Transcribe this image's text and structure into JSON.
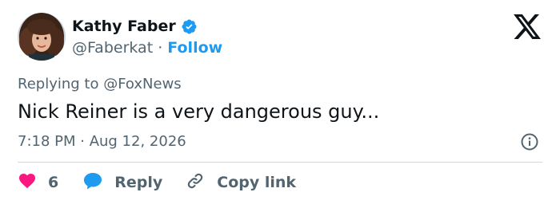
{
  "author": {
    "name": "Kathy Faber",
    "handle": "@Faberkat",
    "separator": "·",
    "follow_label": "Follow",
    "verified": true
  },
  "tweet": {
    "replying_to": "Replying to @FoxNews",
    "text": "Nick Reiner is a very dangerous guy...",
    "timestamp": "7:18 PM · Aug 12, 2026"
  },
  "actions": {
    "like_count": "6",
    "reply_label": "Reply",
    "copy_link_label": "Copy link"
  },
  "icons": {
    "logo": "x-logo-icon",
    "verified": "verified-badge-icon",
    "info": "info-icon",
    "like": "heart-icon",
    "reply": "reply-bubble-icon",
    "copy": "link-icon"
  },
  "colors": {
    "text_primary": "#0f1419",
    "text_secondary": "#536471",
    "accent_blue": "#1d9bf0",
    "like_pink": "#f91880",
    "divider": "#cfd9de"
  }
}
